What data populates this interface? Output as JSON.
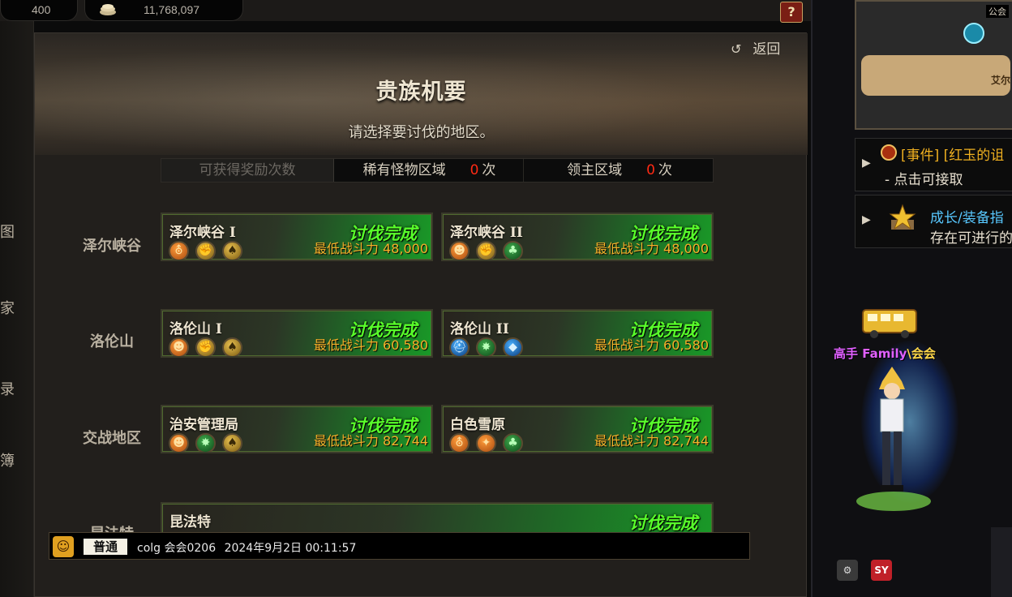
{
  "topbar": {
    "value_a": "400",
    "value_b": "11,768,097",
    "help_icon": "quest-book-icon",
    "coin_icon": "gold-coin-icon"
  },
  "left_strip": {
    "chars": [
      "图",
      "家",
      "录",
      "簿"
    ]
  },
  "panel": {
    "back_label": "返回",
    "title": "贵族机要",
    "subtitle": "请选择要讨伐的地区。",
    "reward_bar": {
      "label": "可获得奖励次数",
      "rare_label": "稀有怪物区域",
      "rare_count": "0",
      "lord_label": "领主区域",
      "lord_count": "0",
      "unit": "次"
    },
    "regions": [
      {
        "label": "泽尔峡谷"
      },
      {
        "label": "洛伦山"
      },
      {
        "label": "交战地区"
      },
      {
        "label": "昆法特"
      }
    ],
    "cards": [
      {
        "name": "泽尔峡谷 I",
        "status": "讨伐完成",
        "power_label": "最低战斗力",
        "power": "48,000",
        "icons": [
          "orange",
          "gold",
          "gold"
        ],
        "icon_names": [
          "silhouette-icon",
          "fist-icon",
          "spade-icon"
        ]
      },
      {
        "name": "泽尔峡谷 II",
        "status": "讨伐完成",
        "power_label": "最低战斗力",
        "power": "48,000",
        "icons": [
          "orange",
          "gold",
          "green"
        ],
        "icon_names": [
          "face-icon",
          "fist-icon",
          "club-icon"
        ]
      },
      {
        "name": "洛伦山 I",
        "status": "讨伐完成",
        "power_label": "最低战斗力",
        "power": "60,580",
        "icons": [
          "orange",
          "gold",
          "gold"
        ],
        "icon_names": [
          "face-icon",
          "fist-icon",
          "spade-icon"
        ]
      },
      {
        "name": "洛伦山 II",
        "status": "讨伐完成",
        "power_label": "最低战斗力",
        "power": "60,580",
        "icons": [
          "blue",
          "green",
          "blue"
        ],
        "icon_names": [
          "helmet-icon",
          "star-icon",
          "diamond-icon"
        ]
      },
      {
        "name": "治安管理局",
        "status": "讨伐完成",
        "power_label": "最低战斗力",
        "power": "82,744",
        "icons": [
          "orange",
          "green",
          "gold"
        ],
        "icon_names": [
          "face-icon",
          "star-icon",
          "spade-icon"
        ]
      },
      {
        "name": "白色雪原",
        "status": "讨伐完成",
        "power_label": "最低战斗力",
        "power": "82,744",
        "icons": [
          "orange",
          "orange",
          "green"
        ],
        "icon_names": [
          "silhouette-icon",
          "flame-icon",
          "club-icon"
        ]
      },
      {
        "name": "昆法特",
        "status": "讨伐完成"
      }
    ]
  },
  "chat": {
    "channel": "普通",
    "sender": "colg 会会0206",
    "timestamp": "2024年9月2日 00:11:57"
  },
  "right": {
    "minimap_label": "艾尔",
    "minimap_corner": "公会",
    "notice_1": {
      "title": "[事件] [红玉的诅",
      "sub": "- 点击可接取"
    },
    "notice_2": {
      "title": "成长/装备指",
      "sub": "存在可进行的"
    },
    "player_name_a": "高手 Family",
    "player_name_b": "\\会会",
    "bottom_icon_b": "SY"
  },
  "colors": {
    "status_green": "#58ff2a",
    "power_gold": "#f5b02a",
    "count_red": "#ff2a14",
    "notice_gold": "#f0b020",
    "notice_blue": "#58c8ff"
  }
}
